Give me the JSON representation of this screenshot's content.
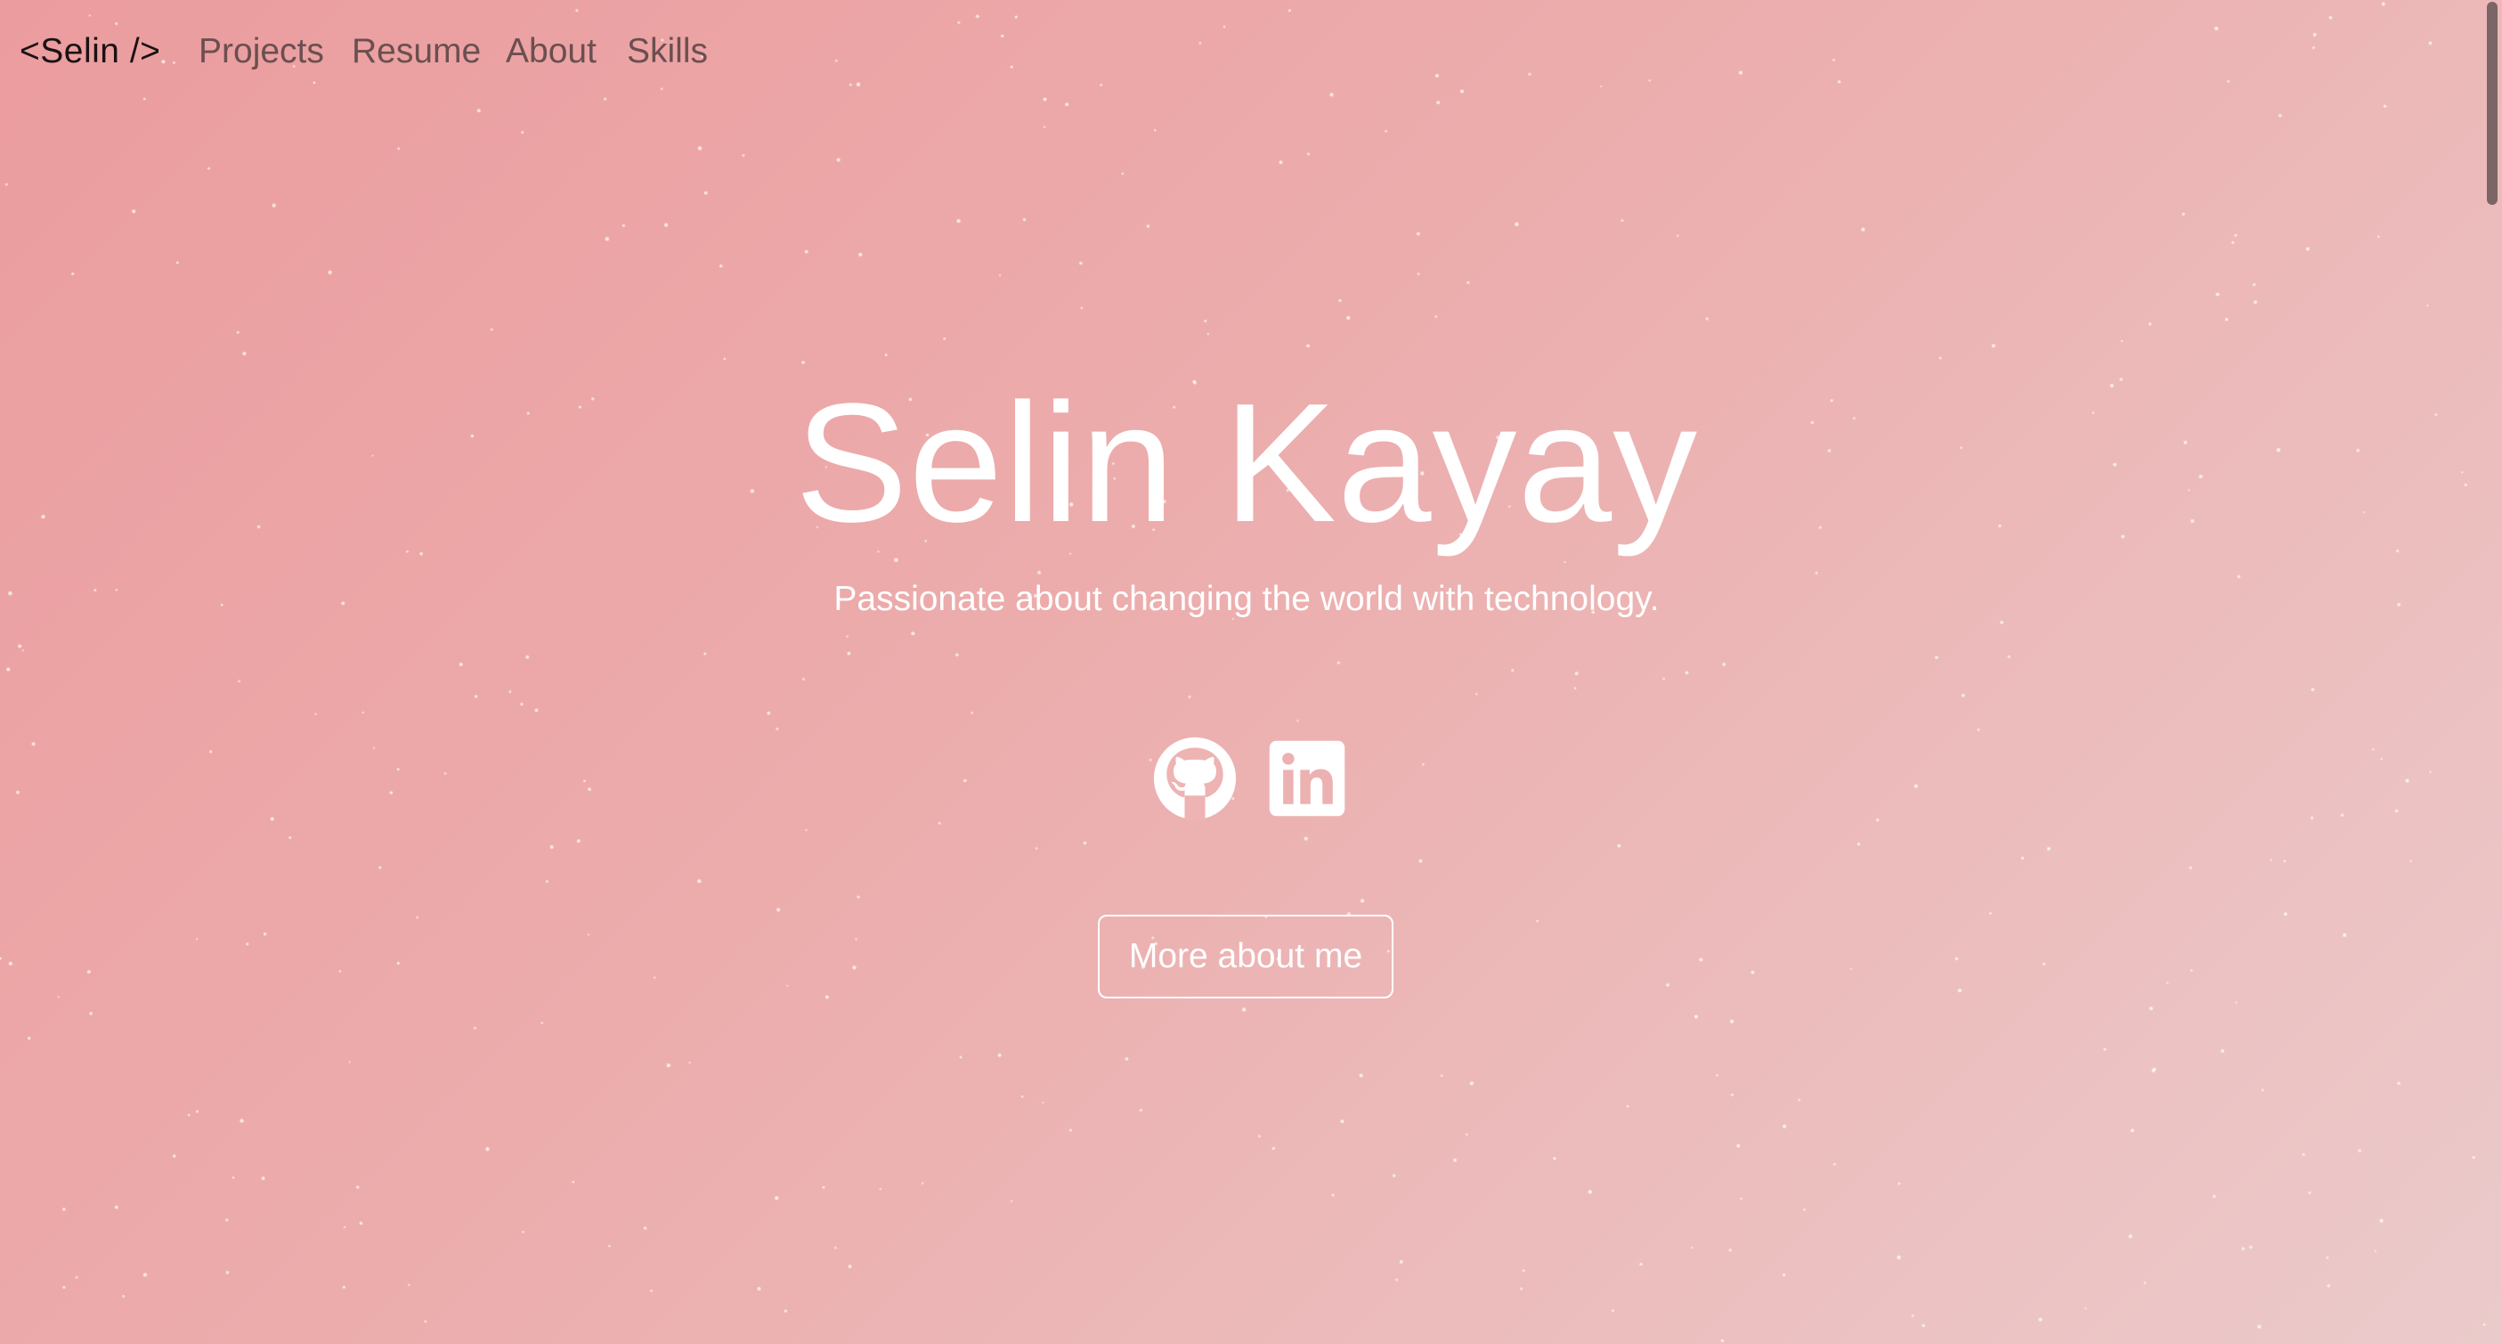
{
  "nav": {
    "brand": "<Selin />",
    "links": [
      "Projects",
      "Resume",
      "About",
      "Skills"
    ]
  },
  "hero": {
    "name": "Selin Kayay",
    "tagline": "Passionate about changing the world with technology.",
    "social": [
      {
        "icon": "github-icon"
      },
      {
        "icon": "linkedin-icon"
      }
    ],
    "cta_label": "More about me"
  },
  "colors": {
    "background_start": "#eb9c9e",
    "background_end": "#ebcacb",
    "hero_text": "#ffffff",
    "nav_text": "#6b4f50",
    "brand_text": "#1a1212"
  },
  "scroll": {
    "position_fraction": 0.0
  }
}
